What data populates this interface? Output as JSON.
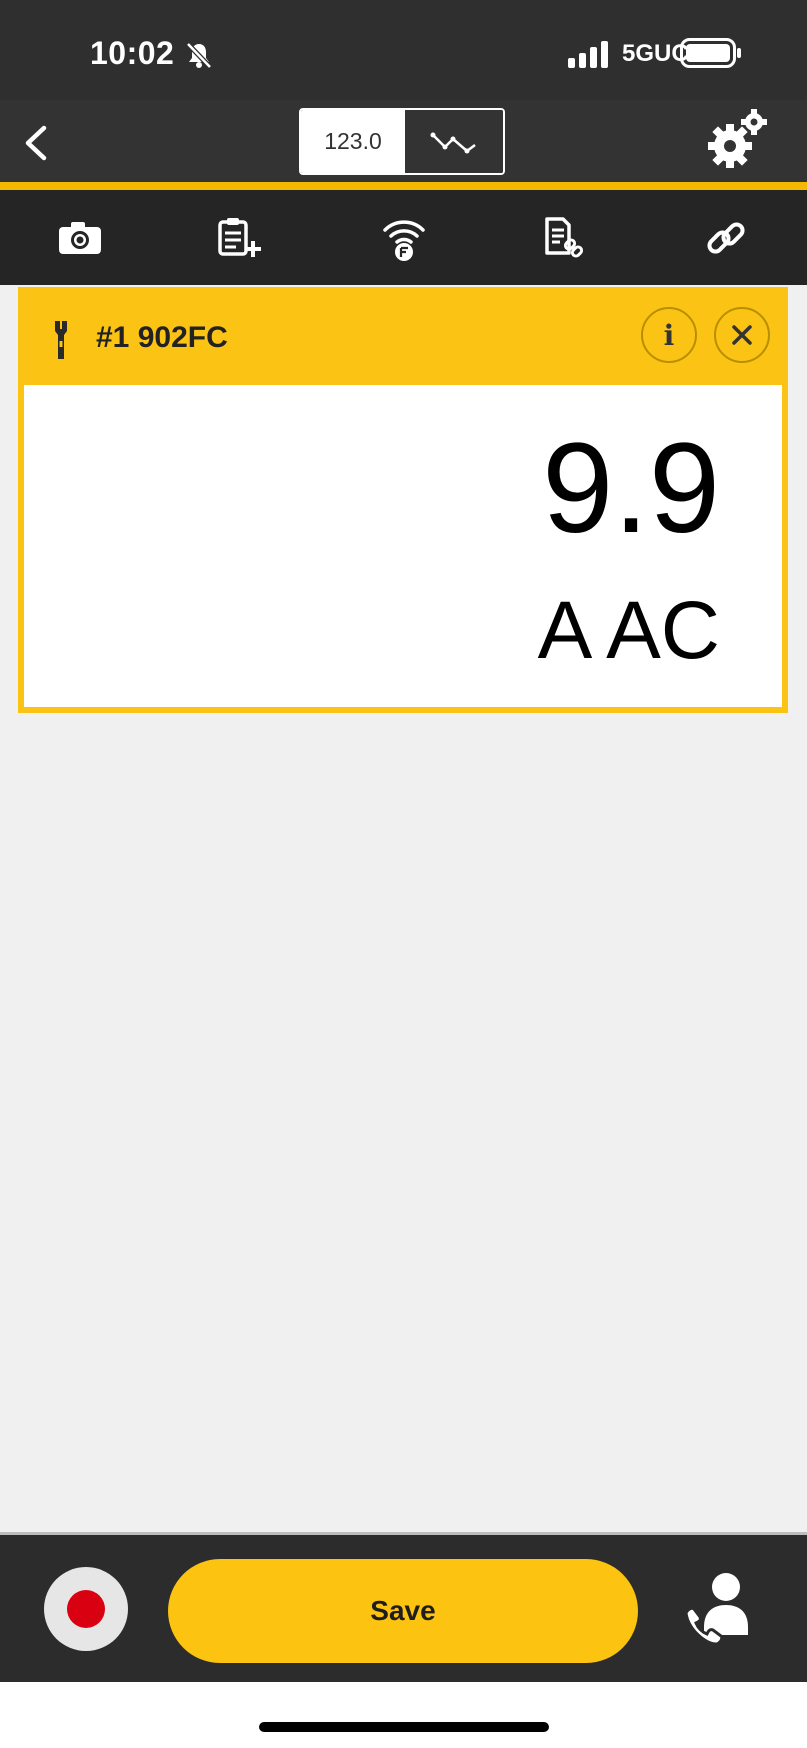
{
  "status_bar": {
    "time": "10:02",
    "network": "5GUC"
  },
  "nav": {
    "toggle_numeric_label": "123.0",
    "toggle_trend_icon": "trend-line-icon",
    "back_icon": "chevron-left-icon",
    "settings_icon": "gears-icon"
  },
  "toolbar": {
    "items": [
      {
        "icon": "camera-icon"
      },
      {
        "icon": "clipboard-add-icon"
      },
      {
        "icon": "wireless-fluke-connect-icon"
      },
      {
        "icon": "document-link-icon"
      },
      {
        "icon": "link-icon"
      }
    ]
  },
  "device": {
    "name": "#1 902FC",
    "reading_value": "9.9",
    "reading_unit": "A AC",
    "info_label": "i"
  },
  "bottom": {
    "save_label": "Save"
  },
  "colors": {
    "accent": "#f5b800",
    "card": "#fbc314",
    "save_button": "#fcc310",
    "record": "#d90012"
  }
}
